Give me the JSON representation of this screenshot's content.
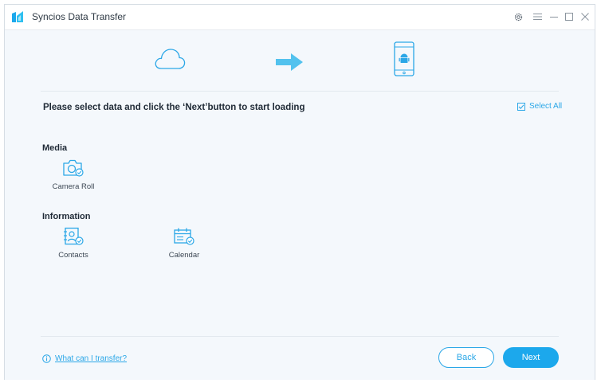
{
  "window": {
    "title": "Syncios Data Transfer"
  },
  "instruction": "Please select data and click the ‘Next’button to start loading",
  "select_all": {
    "label": "Select All",
    "checked": true
  },
  "sections": [
    {
      "title": "Media",
      "items": [
        {
          "label": "Camera Roll",
          "icon": "camera-roll-icon",
          "checked": true
        }
      ]
    },
    {
      "title": "Information",
      "items": [
        {
          "label": "Contacts",
          "icon": "contacts-icon",
          "checked": true
        },
        {
          "label": "Calendar",
          "icon": "calendar-icon",
          "checked": true
        }
      ]
    }
  ],
  "footer": {
    "help_text": "What can I transfer?",
    "back_label": "Back",
    "next_label": "Next"
  },
  "colors": {
    "accent": "#1ca8ec",
    "icon_blue": "#2ba7e7",
    "arrow": "#52c2ee",
    "content_bg": "#f4f8fc",
    "text_dark": "#1f2a36"
  }
}
